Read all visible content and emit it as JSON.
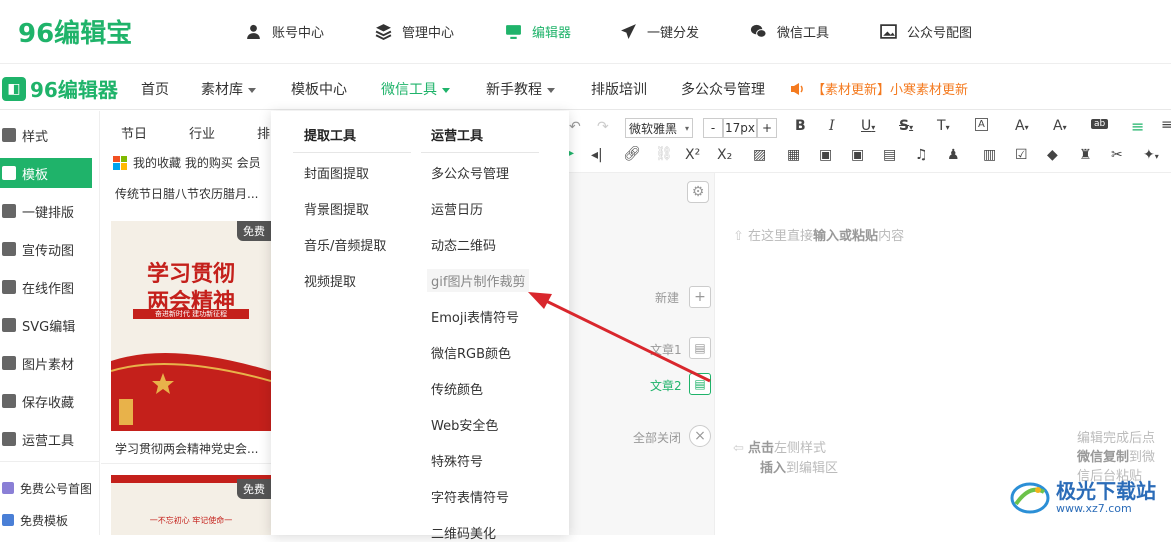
{
  "colors": {
    "brand": "#1fb36a",
    "arrow": "#d9272d",
    "news": "#f47a1f",
    "poster_red": "#c4201b"
  },
  "top_logo": "96编辑宝",
  "top_nav": [
    {
      "label": "账号中心",
      "icon": "user-icon"
    },
    {
      "label": "管理中心",
      "icon": "layers-icon"
    },
    {
      "label": "编辑器",
      "icon": "monitor-icon"
    },
    {
      "label": "一键分发",
      "icon": "send-icon"
    },
    {
      "label": "微信工具",
      "icon": "wechat-icon"
    },
    {
      "label": "公众号配图",
      "icon": "image-icon"
    }
  ],
  "editor_logo": "96编辑器",
  "editor_nav": [
    {
      "label": "首页"
    },
    {
      "label": "素材库"
    },
    {
      "label": "模板中心"
    },
    {
      "label": "微信工具"
    },
    {
      "label": "新手教程"
    },
    {
      "label": "排版培训"
    },
    {
      "label": "多公众号管理"
    }
  ],
  "news_text": "【素材更新】小寒素材更新",
  "sidebar": [
    "样式",
    "模板",
    "一键排版",
    "宣传动图",
    "在线作图",
    "SVG编辑",
    "图片素材",
    "保存收藏",
    "运营工具",
    "免费公号首图",
    "免费模板"
  ],
  "template_tabs": [
    "节日",
    "行业",
    "排"
  ],
  "collect_text": "我的收藏  我的购买  会员",
  "cards": {
    "card1_title": "传统节日腊八节农历腊月...",
    "card2_badge": "免费",
    "card2_poster_line1": "学习贯彻",
    "card2_poster_line2": "两会精神",
    "card2_poster_sub": "奋进新时代 建功新征程",
    "card2_title": "学习贯彻两会精神党史会...",
    "card3_badge": "免费",
    "card3_poster_sub": "一不忘初心 牢记使命一"
  },
  "dropdown": {
    "col1_head": "提取工具",
    "col1": [
      "封面图提取",
      "背景图提取",
      "音乐/音频提取",
      "视频提取"
    ],
    "col2_head": "运营工具",
    "col2": [
      "多公众号管理",
      "运营日历",
      "动态二维码",
      "gif图片制作裁剪",
      "Emoji表情符号",
      "微信RGB颜色",
      "传统颜色",
      "Web安全色",
      "特殊符号",
      "字符表情符号",
      "二维码美化"
    ],
    "hovered_index": 3
  },
  "toolbar": {
    "font_family": "微软雅黑",
    "font_size": "17px",
    "minus": "-",
    "plus": "+"
  },
  "editor": {
    "new_label": "新建",
    "article1": "文章1",
    "article2": "文章2",
    "close_all": "全部关闭",
    "hint_top_pre": "在这里直接",
    "hint_top_bold": "输入或粘贴",
    "hint_top_post": "内容",
    "hint_left_pre": "点击",
    "hint_left_mid": "左侧样式",
    "hint_left_line2_bold": "插入",
    "hint_left_line2": "到编辑区",
    "hint_right_1": "编辑完成后点",
    "hint_right_2_bold": "微信复制",
    "hint_right_2": "到微",
    "hint_right_3": "信后台粘贴"
  },
  "watermark": {
    "text": "极光下载站",
    "url": "www.xz7.com"
  }
}
